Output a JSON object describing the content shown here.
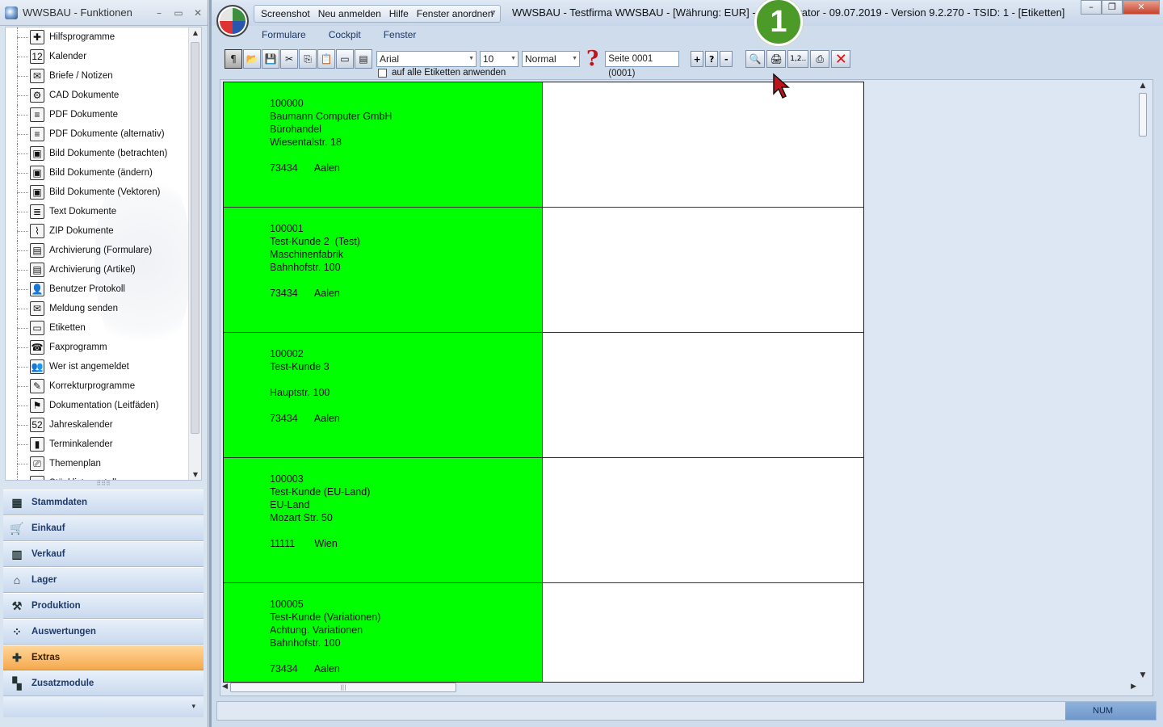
{
  "left_panel": {
    "title": "WWSBAU - Funktionen",
    "window_buttons": [
      "–",
      "▭",
      "✕"
    ],
    "tree_items": [
      {
        "label": "Hilfsprogramme",
        "icon": "toolbox-icon",
        "glyph": "✚"
      },
      {
        "label": "Kalender",
        "icon": "calendar-icon",
        "glyph": "12"
      },
      {
        "label": "Briefe / Notizen",
        "icon": "envelope-icon",
        "glyph": "✉"
      },
      {
        "label": "CAD Dokumente",
        "icon": "cad-icon",
        "glyph": "⚙"
      },
      {
        "label": "PDF Dokumente",
        "icon": "document-icon",
        "glyph": "≡"
      },
      {
        "label": "PDF Dokumente (alternativ)",
        "icon": "document-icon",
        "glyph": "≡"
      },
      {
        "label": "Bild Dokumente (betrachten)",
        "icon": "image-icon",
        "glyph": "▣"
      },
      {
        "label": "Bild Dokumente (ändern)",
        "icon": "image-icon",
        "glyph": "▣"
      },
      {
        "label": "Bild Dokumente (Vektoren)",
        "icon": "image-icon",
        "glyph": "▣"
      },
      {
        "label": "Text Dokumente",
        "icon": "text-document-icon",
        "glyph": "≣"
      },
      {
        "label": "ZIP Dokumente",
        "icon": "zip-icon",
        "glyph": "⌇"
      },
      {
        "label": "Archivierung (Formulare)",
        "icon": "archive-icon",
        "glyph": "▤"
      },
      {
        "label": "Archivierung (Artikel)",
        "icon": "archive-icon",
        "glyph": "▤"
      },
      {
        "label": "Benutzer Protokoll",
        "icon": "users-icon",
        "glyph": "👤"
      },
      {
        "label": "Meldung senden",
        "icon": "send-message-icon",
        "glyph": "✉"
      },
      {
        "label": "Etiketten",
        "icon": "label-icon",
        "glyph": "▭"
      },
      {
        "label": "Faxprogramm",
        "icon": "fax-icon",
        "glyph": "☎"
      },
      {
        "label": "Wer ist angemeldet",
        "icon": "logged-in-users-icon",
        "glyph": "👥"
      },
      {
        "label": "Korrekturprogramme",
        "icon": "tools-icon",
        "glyph": "✎"
      },
      {
        "label": "Dokumentation (Leitfäden)",
        "icon": "signpost-icon",
        "glyph": "⚑"
      },
      {
        "label": "Jahreskalender",
        "icon": "year-calendar-icon",
        "glyph": "52"
      },
      {
        "label": "Terminkalender",
        "icon": "appointment-book-icon",
        "glyph": "▮"
      },
      {
        "label": "Themenplan",
        "icon": "presentation-icon",
        "glyph": "⎚"
      },
      {
        "label": "Stückliste erstellen",
        "icon": "list-icon",
        "glyph": "≡"
      }
    ],
    "nav_buttons": [
      {
        "label": "Stammdaten",
        "icon": "master-data-icon",
        "glyph": "▦",
        "active": false
      },
      {
        "label": "Einkauf",
        "icon": "shopping-cart-icon",
        "glyph": "🛒",
        "active": false
      },
      {
        "label": "Verkauf",
        "icon": "cash-register-icon",
        "glyph": "▥",
        "active": false
      },
      {
        "label": "Lager",
        "icon": "warehouse-icon",
        "glyph": "⌂",
        "active": false
      },
      {
        "label": "Produktion",
        "icon": "production-icon",
        "glyph": "⚒",
        "active": false
      },
      {
        "label": "Auswertungen",
        "icon": "analytics-icon",
        "glyph": "⁘",
        "active": false
      },
      {
        "label": "Extras",
        "icon": "extras-icon",
        "glyph": "✚",
        "active": true
      },
      {
        "label": "Zusatzmodule",
        "icon": "modules-icon",
        "glyph": "▚",
        "active": false
      }
    ]
  },
  "main_window": {
    "quick_access": [
      "Screenshot",
      "Neu anmelden",
      "Hilfe",
      "Fenster anordnen"
    ],
    "title": "WWSBAU - Testfirma WWSBAU - [Währung: EUR] - Administrator - 09.07.2019 - Version 9.2.270 - TSID: 1 - [Etiketten]",
    "menu": [
      "Formulare",
      "Cockpit",
      "Fenster"
    ],
    "step_badge": "1"
  },
  "toolbar": {
    "font_name": "Arial",
    "font_size": "10",
    "font_style": "Normal",
    "help_glyph": "?",
    "page_label": "Seite 0001 (0001)",
    "page_buttons": [
      "+",
      "?",
      "-"
    ],
    "apply_all_label": "auf alle Etiketten anwenden",
    "apply_all_checked": false,
    "numbering_label": "1,2.."
  },
  "labels": [
    {
      "id": "100000",
      "lines": [
        "100000",
        "Baumann Computer GmbH",
        "Bürohandel",
        "Wiesentalstr. 18",
        "",
        "73434      Aalen"
      ]
    },
    {
      "id": "100001",
      "lines": [
        "100001",
        "Test-Kunde 2  (Test)",
        "Maschinenfabrik",
        "Bahnhofstr. 100",
        "",
        "73434      Aalen"
      ]
    },
    {
      "id": "100002",
      "lines": [
        "100002",
        "Test-Kunde 3",
        "",
        "Hauptstr. 100",
        "",
        "73434      Aalen"
      ]
    },
    {
      "id": "100003",
      "lines": [
        "100003",
        "Test-Kunde (EU-Land)",
        "EU-Land",
        "Mozart Str. 50",
        "",
        "11111       Wien"
      ]
    },
    {
      "id": "100005",
      "lines": [
        "100005",
        "Test-Kunde (Variationen)",
        "Achtung. Variationen",
        "Bahnhofstr. 100",
        "",
        "73434      Aalen"
      ]
    }
  ],
  "statusbar": {
    "num_label": "NUM"
  },
  "colors": {
    "label_fill": "#00ff00",
    "active_nav": "#f6a94e",
    "badge": "#4c9a28",
    "close_red": "#d11111"
  }
}
